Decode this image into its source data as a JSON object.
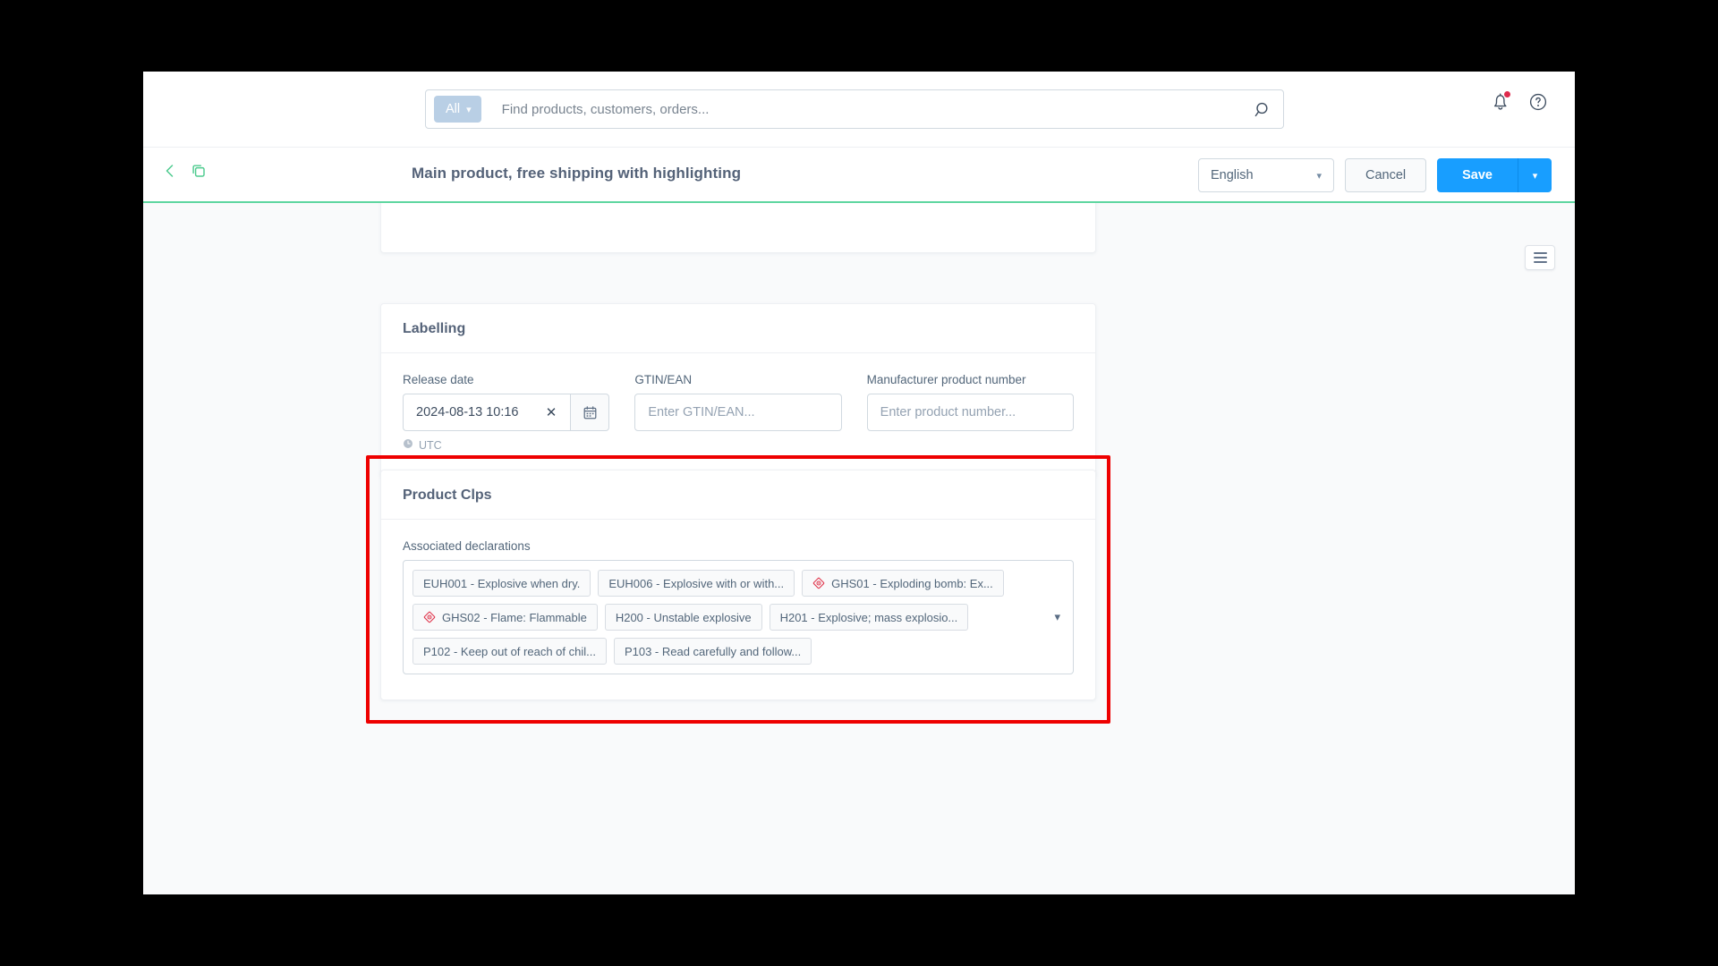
{
  "topbar": {
    "search_scope": "All",
    "search_value": "",
    "search_placeholder": "Find products, customers, orders...",
    "search_icon": "search-icon",
    "notifications_icon": "bell-icon",
    "help_icon": "help-circle-icon"
  },
  "header": {
    "back_icon": "chevron-left-icon",
    "duplicate_icon": "duplicate-icon",
    "title": "Main product, free shipping with highlighting",
    "language": "English",
    "cancel_label": "Cancel",
    "save_label": "Save",
    "save_split_icon": "chevron-down-icon",
    "accent_color": "#5ed6a0",
    "save_color": "#189eff"
  },
  "side_toggle": {
    "icon": "hamburger-icon"
  },
  "labelling": {
    "title": "Labelling",
    "release_date": {
      "label": "Release date",
      "value": "2024-08-13 10:16",
      "clear_icon": "close-icon",
      "calendar_icon": "calendar-icon",
      "timezone_icon": "clock-icon",
      "timezone": "UTC"
    },
    "gtin": {
      "label": "GTIN/EAN",
      "value": "",
      "placeholder": "Enter GTIN/EAN..."
    },
    "manufacturer_number": {
      "label": "Manufacturer product number",
      "value": "",
      "placeholder": "Enter product number..."
    }
  },
  "product_clps": {
    "title": "Product Clps",
    "field_label": "Associated declarations",
    "dropdown_icon": "chevron-down-icon",
    "highlight_color": "#ee0000",
    "chips": [
      {
        "label": "EUH001 - Explosive when dry.",
        "icon": null
      },
      {
        "label": "EUH006 - Explosive with or with...",
        "icon": null
      },
      {
        "label": "GHS01 - Exploding bomb: Ex...",
        "icon": "ghs-hazard-icon"
      },
      {
        "label": "GHS02 - Flame: Flammable",
        "icon": "ghs-hazard-icon"
      },
      {
        "label": "H200 - Unstable explosive",
        "icon": null
      },
      {
        "label": "H201 - Explosive; mass explosio...",
        "icon": null
      },
      {
        "label": "P102 - Keep out of reach of chil...",
        "icon": null
      },
      {
        "label": "P103 - Read carefully and follow...",
        "icon": null
      }
    ]
  }
}
